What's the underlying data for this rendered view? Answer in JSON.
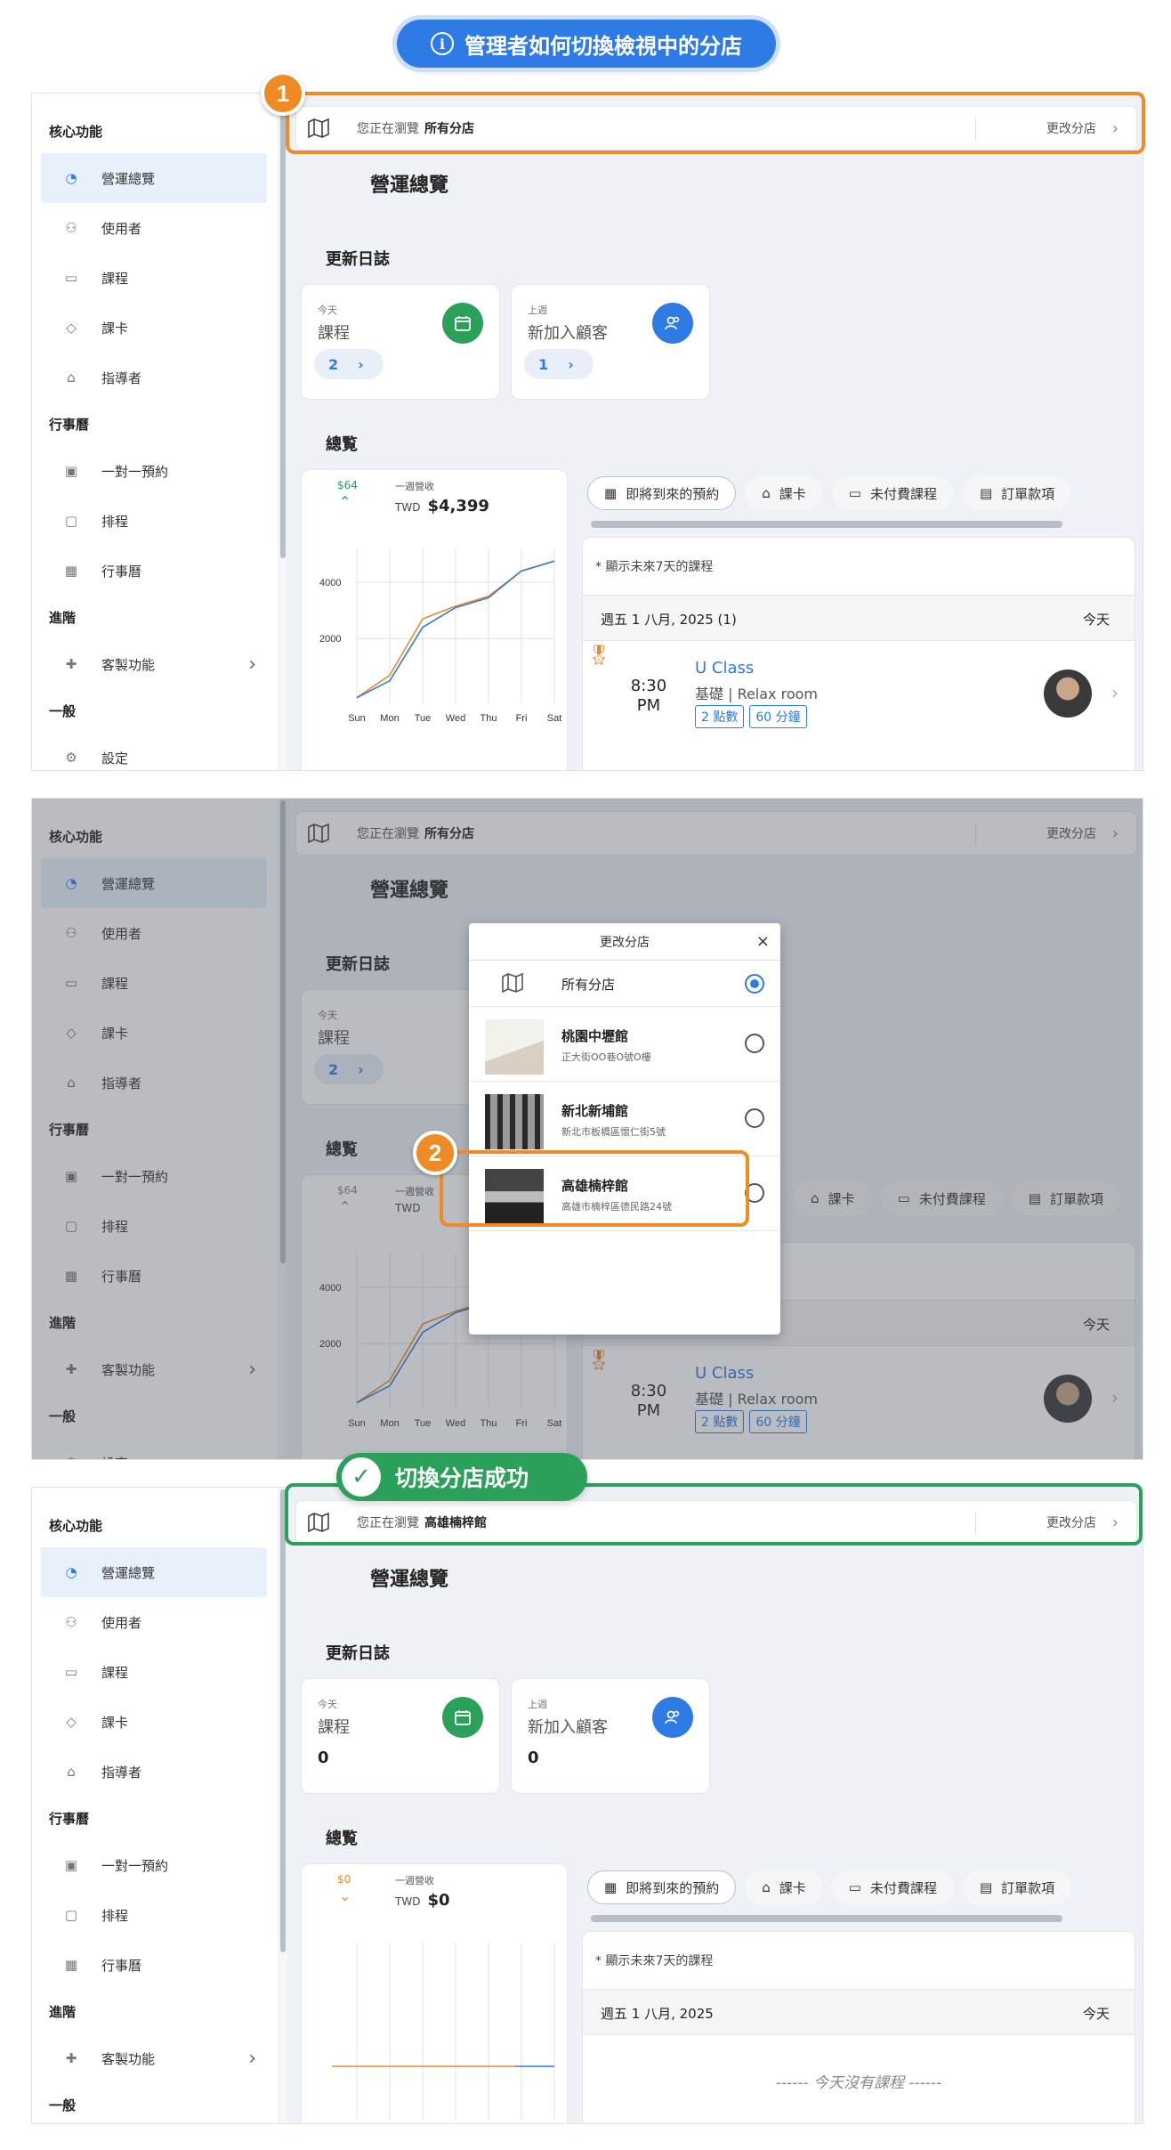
{
  "header": {
    "title": "管理者如何切換檢視中的分店"
  },
  "sidebar": {
    "sections": [
      "核心功能",
      "行事曆",
      "進階",
      "一般"
    ],
    "items": [
      "營運總覽",
      "使用者",
      "課程",
      "課卡",
      "指導者",
      "一對一預約",
      "排程",
      "行事曆",
      "客製功能",
      "設定"
    ]
  },
  "topbar": {
    "browsing": "您正在瀏覽",
    "all_branches": "所有分店",
    "selected_branch": "高雄楠梓館",
    "change": "更改分店"
  },
  "page": {
    "title": "營運總覽",
    "updates": "更新日誌",
    "overview": "總覧"
  },
  "cards": {
    "today": "今天",
    "classes": "課程",
    "last_week": "上週",
    "new_clients": "新加入顧客",
    "before": {
      "classes": "2",
      "clients": "1"
    },
    "after": {
      "classes": "0",
      "clients": "0"
    }
  },
  "revenue": {
    "label": "一週營收",
    "currency": "TWD",
    "before": {
      "delta": "$64",
      "amount": "$4,399"
    },
    "after": {
      "delta": "$0",
      "amount": "$0"
    }
  },
  "chart_data": {
    "type": "line",
    "categories": [
      "Sun",
      "Mon",
      "Tue",
      "Wed",
      "Thu",
      "Fri",
      "Sat"
    ],
    "yticks": [
      2000,
      4000
    ],
    "series": [
      {
        "color": "#f08a24",
        "values": [
          -100,
          700,
          2700,
          3150,
          3500,
          4400,
          4750
        ]
      },
      {
        "color": "#2f7be6",
        "values": [
          -100,
          500,
          2400,
          3100,
          3450,
          4400,
          4750
        ]
      }
    ]
  },
  "tabs": [
    "即將到來的預約",
    "課卡",
    "未付費課程",
    "訂單款項"
  ],
  "schedule": {
    "note": "* 顯示未來7天的課程",
    "date_before": "週五 1 八月, 2025 (1)",
    "date_after": "週五 1 八月, 2025",
    "today": "今天",
    "time": "8:30 PM",
    "class_title": "U Class",
    "class_sub": "基礎 | Relax room",
    "tags": [
      "2 點數",
      "60 分鐘"
    ],
    "empty": "------ 今天沒有課程 ------"
  },
  "modal": {
    "title": "更改分店",
    "branches": [
      {
        "name": "所有分店",
        "addr": ""
      },
      {
        "name": "桃園中壢館",
        "addr": "正大街OO巷O號O樓"
      },
      {
        "name": "新北新埔館",
        "addr": "新北市板橋區懷仁街5號"
      },
      {
        "name": "高雄楠梓館",
        "addr": "高雄市楠梓區德民路24號"
      }
    ]
  },
  "steps": [
    "1",
    "2"
  ],
  "success": "切換分店成功",
  "colors": {
    "accent": "#2f7be6",
    "step": "#f08a24",
    "success": "#2ba05a"
  }
}
